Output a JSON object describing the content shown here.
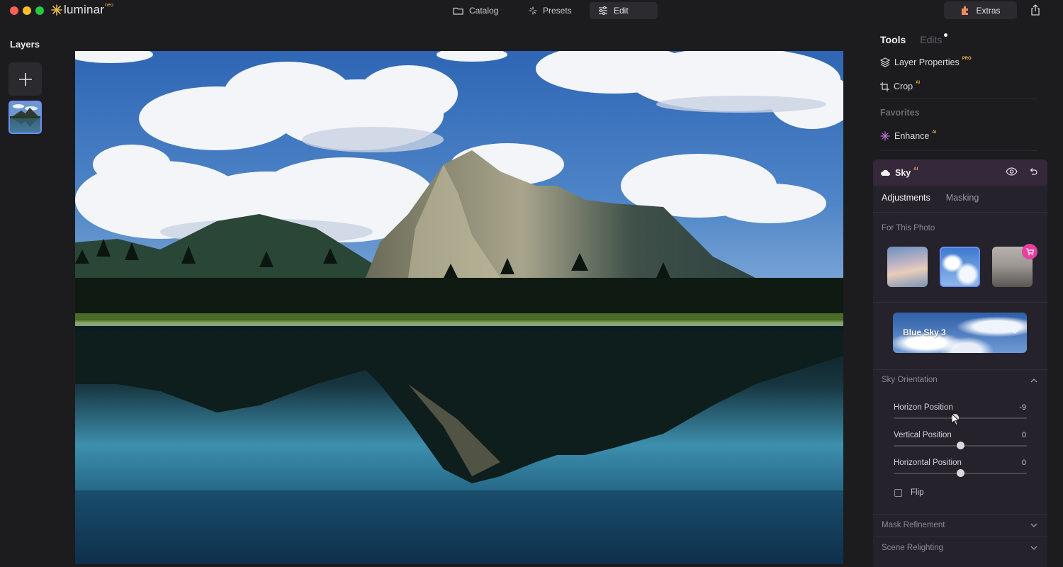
{
  "app": {
    "logo_text": "luminar",
    "logo_badge": "neo"
  },
  "topnav": {
    "catalog": "Catalog",
    "presets": "Presets",
    "edit": "Edit",
    "active": "Edit"
  },
  "extras": {
    "label": "Extras"
  },
  "layers": {
    "title": "Layers"
  },
  "panel": {
    "tabs": {
      "tools": "Tools",
      "edits": "Edits"
    },
    "tools": [
      {
        "label": "Layer Properties",
        "badge": "PRO",
        "icon": "layers-icon"
      },
      {
        "label": "Crop",
        "badge": "AI",
        "icon": "crop-icon"
      }
    ],
    "favorites_title": "Favorites",
    "favorites": [
      {
        "label": "Enhance",
        "badge": "AI",
        "icon": "sparkle-icon"
      }
    ]
  },
  "sky": {
    "title": "Sky",
    "badge": "AI",
    "subtabs": {
      "adjustments": "Adjustments",
      "masking": "Masking"
    },
    "for_this_photo": "For This Photo",
    "selected_sky": "Blue Sky 3",
    "orientation": {
      "title": "Sky Orientation",
      "sliders": [
        {
          "label": "Horizon Position",
          "value": "-9",
          "level": 0.455
        },
        {
          "label": "Vertical Position",
          "value": "0",
          "level": 0.5
        },
        {
          "label": "Horizontal Position",
          "value": "0",
          "level": 0.5
        }
      ],
      "flip_label": "Flip"
    },
    "mask_refinement": "Mask Refinement",
    "scene_relighting": "Scene Relighting"
  },
  "colors": {
    "accent_blue": "#6a8ff2",
    "logo_gold": "#e9b84a",
    "cart_pink": "#e63fa0",
    "sky_header": "#35283a"
  }
}
